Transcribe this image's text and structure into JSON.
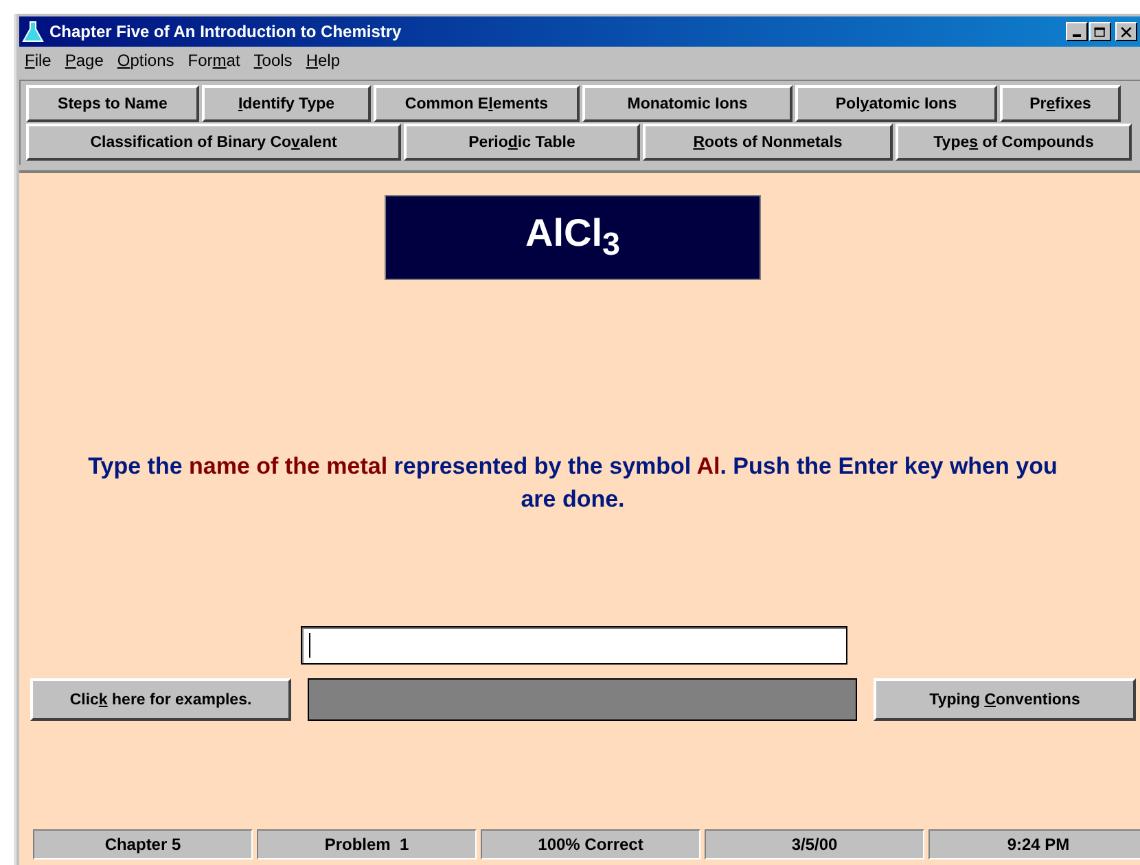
{
  "window": {
    "title": "Chapter Five of An Introduction to Chemistry"
  },
  "menu": [
    {
      "key": "F",
      "after": "ile"
    },
    {
      "key": "P",
      "after": "age"
    },
    {
      "key": "O",
      "after": "ptions"
    },
    {
      "before": "For",
      "key": "m",
      "after": "at"
    },
    {
      "key": "T",
      "after": "ools"
    },
    {
      "key": "H",
      "after": "elp"
    }
  ],
  "toolbar_rows": [
    [
      {
        "before": "Steps to Name"
      },
      {
        "key": "I",
        "after": "dentify Type"
      },
      {
        "before": "Common E",
        "key": "l",
        "after": "ements"
      },
      {
        "before": "Monatomic Ions"
      },
      {
        "before": "Pol",
        "key": "y",
        "after": "atomic Ions"
      },
      {
        "before": "Pr",
        "key": "e",
        "after": "fixes"
      }
    ],
    [
      {
        "before": "Classification of Binary Co",
        "key": "v",
        "after": "alent"
      },
      {
        "before": "Perio",
        "key": "d",
        "after": "ic Table"
      },
      {
        "key": "R",
        "after": "oots of Nonmetals"
      },
      {
        "before": "Type",
        "key": "s",
        "after": " of Compounds"
      }
    ]
  ],
  "formula": "AlCl$_{3}$",
  "instruction": [
    {
      "text": "Type the ",
      "emphasis": false
    },
    {
      "text": "name of the metal",
      "emphasis": true
    },
    {
      "text": " represented by the symbol ",
      "emphasis": false
    },
    {
      "text": "Al",
      "emphasis": true
    },
    {
      "text": ". Push the Enter key when you are done.",
      "emphasis": false
    }
  ],
  "examples_button": {
    "before": "Clic",
    "key": "k",
    "after": " here for examples."
  },
  "conventions_button": {
    "before": "Typing ",
    "key": "C",
    "after": "onventions"
  },
  "status_bar": [
    "Chapter 5",
    "Problem  1",
    "100% Correct",
    "3/5/00",
    "9:24 PM"
  ]
}
